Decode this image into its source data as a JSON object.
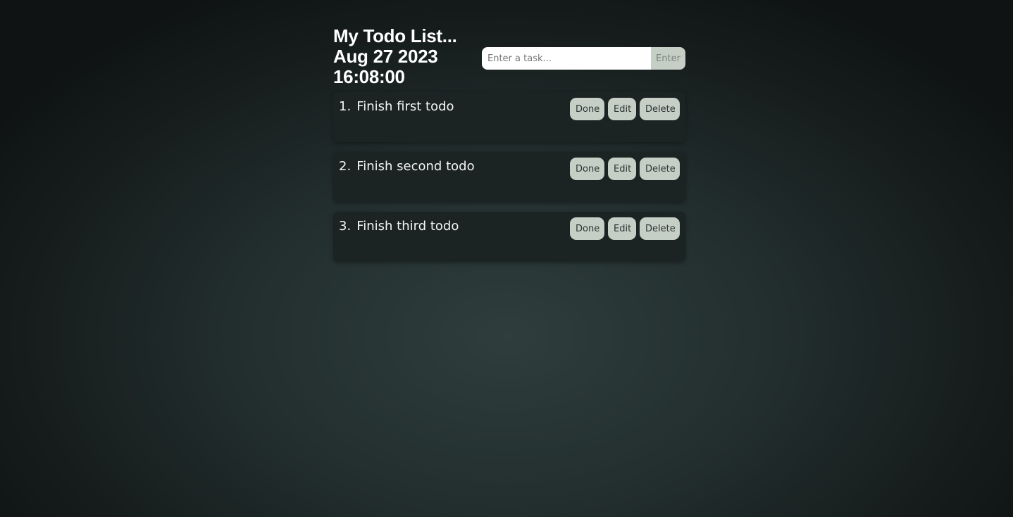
{
  "header": {
    "title": "My Todo List...",
    "date": "Aug 27 2023",
    "time": "16:08:00"
  },
  "form": {
    "placeholder": "Enter a task...",
    "value": "",
    "enter_label": "Enter"
  },
  "todos": [
    {
      "index": "1.",
      "text": "Finish first todo",
      "done_label": "Done",
      "edit_label": "Edit",
      "delete_label": "Delete"
    },
    {
      "index": "2.",
      "text": "Finish second todo",
      "done_label": "Done",
      "edit_label": "Edit",
      "delete_label": "Delete"
    },
    {
      "index": "3.",
      "text": "Finish third todo",
      "done_label": "Done",
      "edit_label": "Edit",
      "delete_label": "Delete"
    }
  ],
  "colors": {
    "background_center": "#2f3d3d",
    "background_edge": "#0f1313",
    "card": "#1c2323",
    "button": "#c5cfc6",
    "button_text": "#2d3434"
  }
}
